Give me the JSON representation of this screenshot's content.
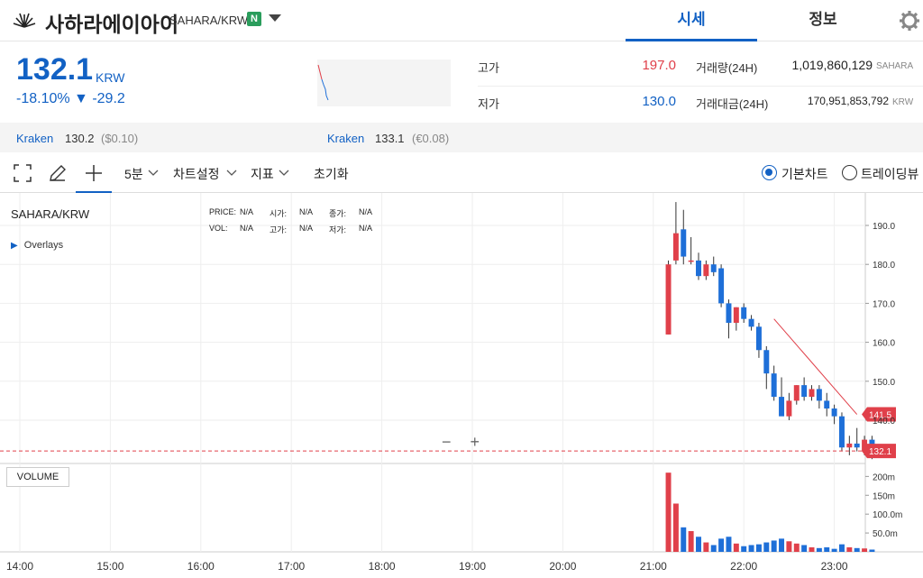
{
  "header": {
    "coin_name": "사하라에이아이",
    "pair": "SAHARA/KRW",
    "badge": "N",
    "tabs": [
      "시세",
      "정보"
    ]
  },
  "price": {
    "value": "132.1",
    "unit": "KRW",
    "change": "-18.10% ▼ -29.2"
  },
  "stats": {
    "high_label": "고가",
    "high": "197.0",
    "low_label": "저가",
    "low": "130.0",
    "volume_label": "거래량(24H)",
    "volume": "1,019,860,129",
    "volume_unit": "SAHARA",
    "amount_label": "거래대금(24H)",
    "amount": "170,951,853,792",
    "amount_unit": "KRW"
  },
  "exchanges": [
    {
      "name": "Kraken",
      "price": "130.2",
      "sub": "($0.10)"
    },
    {
      "name": "Kraken",
      "price": "133.1",
      "sub": "(€0.08)"
    }
  ],
  "toolbar": {
    "interval": "5분",
    "chart_settings": "차트설정",
    "indicators": "지표",
    "reset": "초기화",
    "basic_chart": "기본차트",
    "tradingview": "트레이딩뷰"
  },
  "chart_panel": {
    "symbol": "SAHARA/KRW",
    "overlays": "Overlays",
    "legend": {
      "price_label": "PRICE:",
      "price": "N/A",
      "open_label": "시가:",
      "open": "N/A",
      "close_label": "종가:",
      "close": "N/A",
      "vol_label": "VOL:",
      "vol": "N/A",
      "high_label": "고가:",
      "high": "N/A",
      "low_label": "저가:",
      "low": "N/A"
    },
    "volume_button": "VOLUME",
    "zoom_minus": "−",
    "zoom_plus": "+",
    "last_price_tag": "132.1",
    "line_tag": "141.5"
  },
  "colors": {
    "accent": "#1261c4",
    "up": "#e0404a",
    "down": "#1e6fd8",
    "badge": "#2a9d5c"
  },
  "chart_data": {
    "type": "candlestick",
    "x_ticks": [
      "14:00",
      "15:00",
      "16:00",
      "17:00",
      "18:00",
      "19:00",
      "20:00",
      "21:00",
      "22:00",
      "23:00"
    ],
    "y_ticks": [
      190.0,
      180.0,
      170.0,
      160.0,
      150.0,
      140.0
    ],
    "y_tick_labels": [
      "190.0",
      "180.0",
      "170.0",
      "160.0",
      "150.0",
      "140.0"
    ],
    "volume_ticks": [
      "200m",
      "150m",
      "100.0m",
      "50.0m"
    ],
    "ylim": [
      130,
      197
    ],
    "volume_max": 220,
    "candle_interval_min": 5,
    "first_candle_time": "21:10",
    "candles": [
      {
        "o": 162,
        "h": 181,
        "l": 162,
        "c": 180,
        "v": 210
      },
      {
        "o": 181,
        "h": 196,
        "l": 180,
        "c": 188,
        "v": 128
      },
      {
        "o": 189,
        "h": 194,
        "l": 180,
        "c": 182,
        "v": 65
      },
      {
        "o": 181,
        "h": 187,
        "l": 180,
        "c": 181,
        "v": 55
      },
      {
        "o": 181,
        "h": 183,
        "l": 176,
        "c": 177,
        "v": 40
      },
      {
        "o": 177,
        "h": 181,
        "l": 176,
        "c": 180,
        "v": 25
      },
      {
        "o": 180,
        "h": 182,
        "l": 177,
        "c": 178,
        "v": 18
      },
      {
        "o": 179,
        "h": 180,
        "l": 169,
        "c": 170,
        "v": 35
      },
      {
        "o": 170,
        "h": 171,
        "l": 161,
        "c": 165,
        "v": 40
      },
      {
        "o": 165,
        "h": 169,
        "l": 163,
        "c": 169,
        "v": 22
      },
      {
        "o": 169,
        "h": 170,
        "l": 165,
        "c": 166,
        "v": 15
      },
      {
        "o": 166,
        "h": 167,
        "l": 163,
        "c": 164,
        "v": 18
      },
      {
        "o": 164,
        "h": 165,
        "l": 156,
        "c": 158,
        "v": 20
      },
      {
        "o": 158,
        "h": 159,
        "l": 148,
        "c": 152,
        "v": 25
      },
      {
        "o": 152,
        "h": 154,
        "l": 145,
        "c": 146,
        "v": 30
      },
      {
        "o": 146,
        "h": 151,
        "l": 143,
        "c": 141,
        "v": 35
      },
      {
        "o": 141,
        "h": 147,
        "l": 140,
        "c": 145,
        "v": 28
      },
      {
        "o": 145,
        "h": 149,
        "l": 144,
        "c": 149,
        "v": 22
      },
      {
        "o": 149,
        "h": 151,
        "l": 145,
        "c": 146,
        "v": 18
      },
      {
        "o": 146,
        "h": 149,
        "l": 145,
        "c": 148,
        "v": 12
      },
      {
        "o": 148,
        "h": 149,
        "l": 143,
        "c": 145,
        "v": 10
      },
      {
        "o": 145,
        "h": 147,
        "l": 141,
        "c": 143,
        "v": 12
      },
      {
        "o": 143,
        "h": 144,
        "l": 139,
        "c": 141,
        "v": 8
      },
      {
        "o": 141,
        "h": 142,
        "l": 132,
        "c": 133,
        "v": 20
      },
      {
        "o": 133,
        "h": 136,
        "l": 131,
        "c": 134,
        "v": 12
      },
      {
        "o": 134,
        "h": 138,
        "l": 132,
        "c": 133,
        "v": 10
      },
      {
        "o": 132,
        "h": 136,
        "l": 131,
        "c": 135,
        "v": 9
      },
      {
        "o": 135,
        "h": 136,
        "l": 130,
        "c": 132.1,
        "v": 6
      }
    ],
    "trendline": [
      {
        "x": "22:20",
        "y": 166
      },
      {
        "x": "23:15",
        "y": 141.5
      }
    ],
    "last_price": 132.1
  }
}
